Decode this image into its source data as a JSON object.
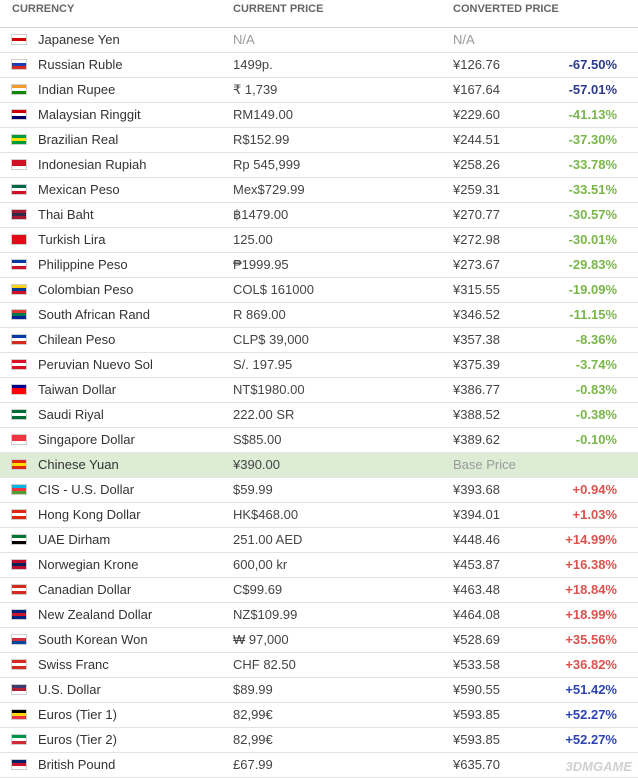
{
  "header": {
    "currency": "CURRENCY",
    "current_price": "CURRENT PRICE",
    "converted_price": "CONVERTED PRICE"
  },
  "rows": [
    {
      "name": "Japanese Yen",
      "price": "N/A",
      "converted": "N/A",
      "diff": "",
      "tone": "na",
      "flag": [
        "#ffffff",
        "#d40000",
        "#ffffff"
      ]
    },
    {
      "name": "Russian Ruble",
      "price": "1499p.",
      "converted": "¥126.76",
      "diff": "-67.50%",
      "tone": "darkblue",
      "flag": [
        "#ffffff",
        "#1c3fb4",
        "#d52b1e"
      ]
    },
    {
      "name": "Indian Rupee",
      "price": "₹ 1,739",
      "converted": "¥167.64",
      "diff": "-57.01%",
      "tone": "darkblue",
      "flag": [
        "#f49a2e",
        "#ffffff",
        "#138808"
      ]
    },
    {
      "name": "Malaysian Ringgit",
      "price": "RM149.00",
      "converted": "¥229.60",
      "diff": "-41.13%",
      "tone": "green",
      "flag": [
        "#cc0000",
        "#ffffff",
        "#010066"
      ]
    },
    {
      "name": "Brazilian Real",
      "price": "R$152.99",
      "converted": "¥244.51",
      "diff": "-37.30%",
      "tone": "green",
      "flag": [
        "#009c3b",
        "#ffdf00",
        "#009c3b"
      ]
    },
    {
      "name": "Indonesian Rupiah",
      "price": "Rp 545,999",
      "converted": "¥258.26",
      "diff": "-33.78%",
      "tone": "green",
      "flag": [
        "#ce1126",
        "#ce1126",
        "#ffffff"
      ]
    },
    {
      "name": "Mexican Peso",
      "price": "Mex$729.99",
      "converted": "¥259.31",
      "diff": "-33.51%",
      "tone": "green",
      "flag": [
        "#006847",
        "#ffffff",
        "#ce1126"
      ]
    },
    {
      "name": "Thai Baht",
      "price": "฿1479.00",
      "converted": "¥270.77",
      "diff": "-30.57%",
      "tone": "green",
      "flag": [
        "#a51931",
        "#2d2a4a",
        "#a51931"
      ]
    },
    {
      "name": "Turkish Lira",
      "price": "125.00",
      "converted": "¥272.98",
      "diff": "-30.01%",
      "tone": "green",
      "flag": [
        "#e30a17",
        "#e30a17",
        "#e30a17"
      ]
    },
    {
      "name": "Philippine Peso",
      "price": "₱1999.95",
      "converted": "¥273.67",
      "diff": "-29.83%",
      "tone": "green",
      "flag": [
        "#0038a8",
        "#ffffff",
        "#ce1126"
      ]
    },
    {
      "name": "Colombian Peso",
      "price": "COL$ 161000",
      "converted": "¥315.55",
      "diff": "-19.09%",
      "tone": "green",
      "flag": [
        "#fcd116",
        "#003893",
        "#ce1126"
      ]
    },
    {
      "name": "South African Rand",
      "price": "R 869.00",
      "converted": "¥346.52",
      "diff": "-11.15%",
      "tone": "green",
      "flag": [
        "#de3831",
        "#007a4d",
        "#002395"
      ]
    },
    {
      "name": "Chilean Peso",
      "price": "CLP$ 39,000",
      "converted": "¥357.38",
      "diff": "-8.36%",
      "tone": "green",
      "flag": [
        "#0039a6",
        "#ffffff",
        "#d52b1e"
      ]
    },
    {
      "name": "Peruvian Nuevo Sol",
      "price": "S/. 197.95",
      "converted": "¥375.39",
      "diff": "-3.74%",
      "tone": "green",
      "flag": [
        "#d91023",
        "#ffffff",
        "#d91023"
      ]
    },
    {
      "name": "Taiwan Dollar",
      "price": "NT$1980.00",
      "converted": "¥386.77",
      "diff": "-0.83%",
      "tone": "green",
      "flag": [
        "#000095",
        "#fe0000",
        "#fe0000"
      ]
    },
    {
      "name": "Saudi Riyal",
      "price": "222.00 SR",
      "converted": "¥388.52",
      "diff": "-0.38%",
      "tone": "green",
      "flag": [
        "#006c35",
        "#ffffff",
        "#006c35"
      ]
    },
    {
      "name": "Singapore Dollar",
      "price": "S$85.00",
      "converted": "¥389.62",
      "diff": "-0.10%",
      "tone": "green",
      "flag": [
        "#ef3340",
        "#ef3340",
        "#ffffff"
      ]
    },
    {
      "name": "Chinese Yuan",
      "price": "¥390.00",
      "converted": "Base Price",
      "diff": "",
      "tone": "base",
      "flag": [
        "#de2910",
        "#ffde00",
        "#de2910"
      ]
    },
    {
      "name": "CIS - U.S. Dollar",
      "price": "$59.99",
      "converted": "¥393.68",
      "diff": "+0.94%",
      "tone": "red",
      "flag": [
        "#00b5e2",
        "#ef3340",
        "#509e2f"
      ]
    },
    {
      "name": "Hong Kong Dollar",
      "price": "HK$468.00",
      "converted": "¥394.01",
      "diff": "+1.03%",
      "tone": "red",
      "flag": [
        "#de2910",
        "#ffffff",
        "#de2910"
      ]
    },
    {
      "name": "UAE Dirham",
      "price": "251.00 AED",
      "converted": "¥448.46",
      "diff": "+14.99%",
      "tone": "red",
      "flag": [
        "#00732f",
        "#ffffff",
        "#000000"
      ]
    },
    {
      "name": "Norwegian Krone",
      "price": "600,00 kr",
      "converted": "¥453.87",
      "diff": "+16.38%",
      "tone": "red",
      "flag": [
        "#ba0c2f",
        "#00205b",
        "#ba0c2f"
      ]
    },
    {
      "name": "Canadian Dollar",
      "price": "C$99.69",
      "converted": "¥463.48",
      "diff": "+18.84%",
      "tone": "red",
      "flag": [
        "#d52b1e",
        "#ffffff",
        "#d52b1e"
      ]
    },
    {
      "name": "New Zealand Dollar",
      "price": "NZ$109.99",
      "converted": "¥464.08",
      "diff": "+18.99%",
      "tone": "red",
      "flag": [
        "#00247d",
        "#cc142b",
        "#00247d"
      ]
    },
    {
      "name": "South Korean Won",
      "price": "₩ 97,000",
      "converted": "¥528.69",
      "diff": "+35.56%",
      "tone": "red",
      "flag": [
        "#ffffff",
        "#cd2e3a",
        "#0047a0"
      ]
    },
    {
      "name": "Swiss Franc",
      "price": "CHF 82.50",
      "converted": "¥533.58",
      "diff": "+36.82%",
      "tone": "red",
      "flag": [
        "#d52b1e",
        "#ffffff",
        "#d52b1e"
      ]
    },
    {
      "name": "U.S. Dollar",
      "price": "$89.99",
      "converted": "¥590.55",
      "diff": "+51.42%",
      "tone": "blue",
      "flag": [
        "#3c3b6e",
        "#b22234",
        "#ffffff"
      ]
    },
    {
      "name": "Euros (Tier 1)",
      "price": "82,99€",
      "converted": "¥593.85",
      "diff": "+52.27%",
      "tone": "blue",
      "flag": [
        "#000000",
        "#ffd90c",
        "#ef3340"
      ]
    },
    {
      "name": "Euros (Tier 2)",
      "price": "82,99€",
      "converted": "¥593.85",
      "diff": "+52.27%",
      "tone": "blue",
      "flag": [
        "#009246",
        "#ffffff",
        "#ce2b37"
      ]
    },
    {
      "name": "British Pound",
      "price": "£67.99",
      "converted": "¥635.70",
      "diff": "",
      "tone": "blue",
      "flag": [
        "#012169",
        "#c8102e",
        "#ffffff"
      ]
    }
  ],
  "watermark": "3DMGAME"
}
